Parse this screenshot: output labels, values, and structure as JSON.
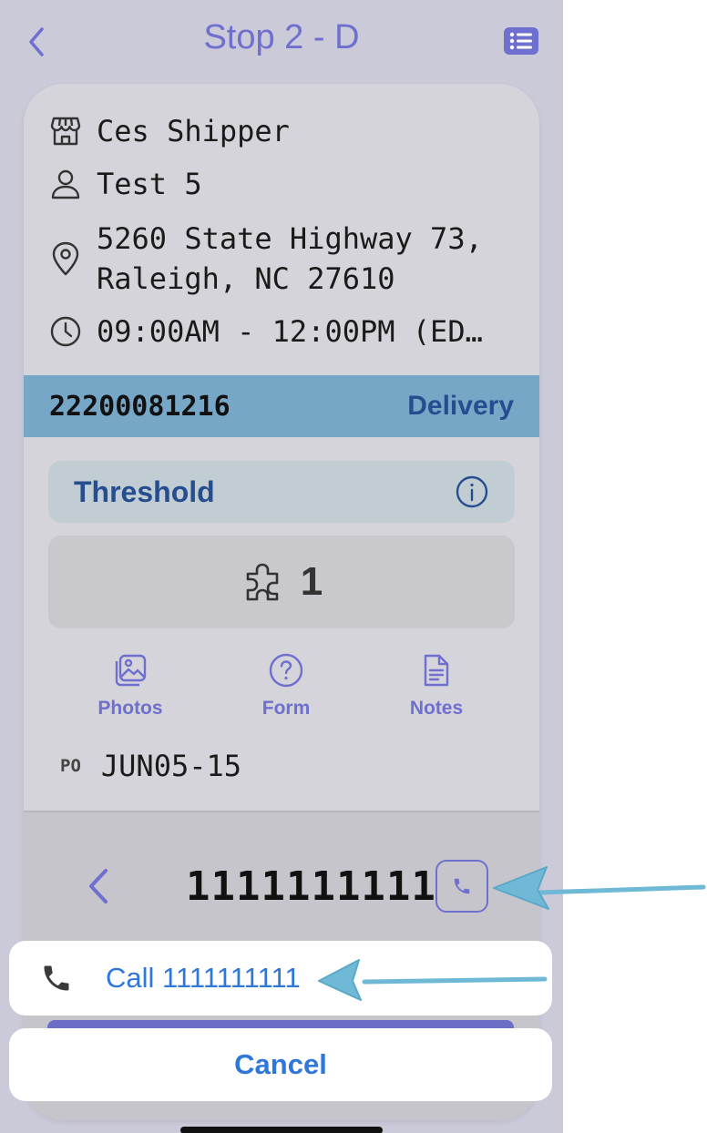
{
  "header": {
    "title": "Stop 2 - D",
    "back_icon": "chevron-left-icon",
    "list_icon": "list-icon"
  },
  "stop": {
    "shipper": "Ces Shipper",
    "contact": "Test 5",
    "address_line1": "5260 State Highway 73,",
    "address_line2": "Raleigh, NC 27610",
    "time_window": "09:00AM - 12:00PM (ED…"
  },
  "order": {
    "number": "22200081216",
    "type": "Delivery"
  },
  "threshold": {
    "label": "Threshold"
  },
  "pieces": {
    "count": "1"
  },
  "actions": [
    {
      "label": "Photos",
      "icon": "photo-icon"
    },
    {
      "label": "Form",
      "icon": "question-circle-icon"
    },
    {
      "label": "Notes",
      "icon": "document-icon"
    }
  ],
  "po": {
    "label": "PO",
    "value": "JUN05-15"
  },
  "phone": {
    "number": "1111111111"
  },
  "action_sheet": {
    "call_label": "Call 1111111111",
    "cancel_label": "Cancel"
  },
  "colors": {
    "accent": "#6e6fce",
    "link_blue": "#2f77d8",
    "order_bar": "#77a7c6",
    "annotation_arrow": "#6fb9d6"
  }
}
